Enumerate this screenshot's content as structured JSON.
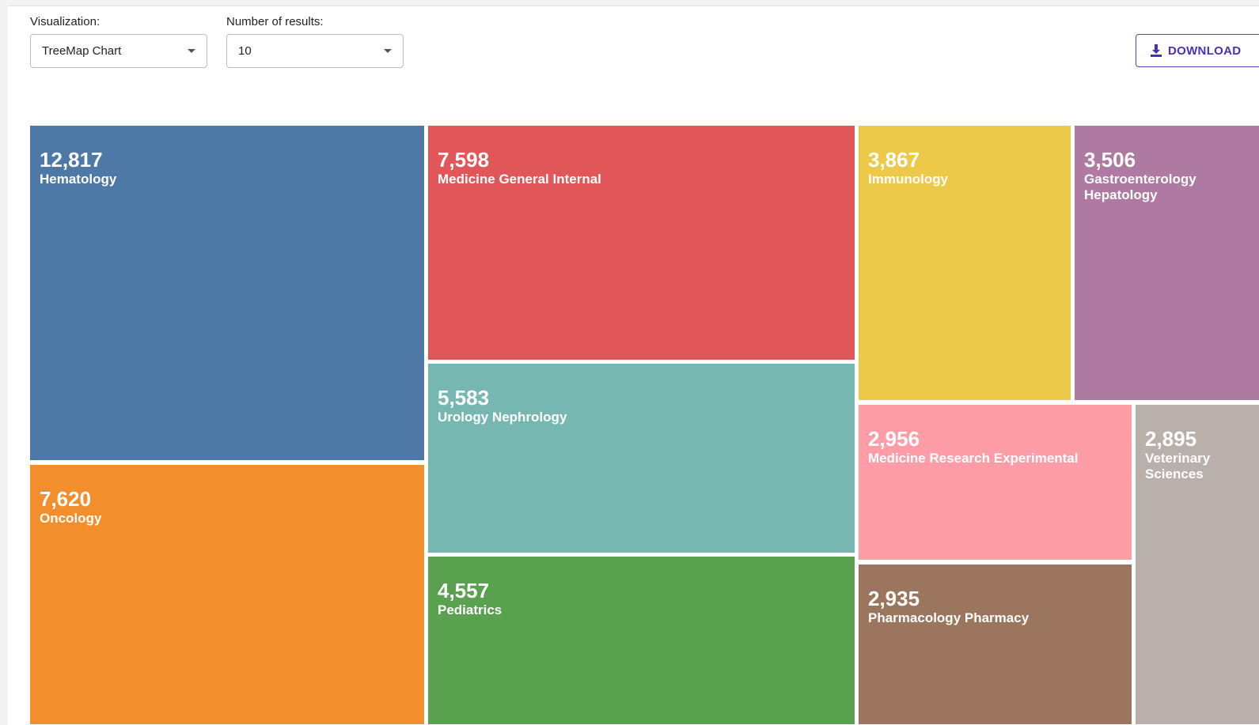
{
  "controls": {
    "visualization_label": "Visualization:",
    "visualization_value": "TreeMap Chart",
    "results_label": "Number of results:",
    "results_value": "10",
    "download_label": "DOWNLOAD"
  },
  "icons": {
    "dropdown": "chevron-down-icon",
    "download": "download-icon"
  },
  "chart_data": {
    "type": "treemap",
    "title": "",
    "items": [
      {
        "label": "Hematology",
        "value": 12817,
        "value_text": "12,817",
        "color": "#4e79a7"
      },
      {
        "label": "Oncology",
        "value": 7620,
        "value_text": "7,620",
        "color": "#f28e2b"
      },
      {
        "label": "Medicine General Internal",
        "value": 7598,
        "value_text": "7,598",
        "color": "#e15759"
      },
      {
        "label": "Urology Nephrology",
        "value": 5583,
        "value_text": "5,583",
        "color": "#76b7b2"
      },
      {
        "label": "Pediatrics",
        "value": 4557,
        "value_text": "4,557",
        "color": "#59a14f"
      },
      {
        "label": "Immunology",
        "value": 3867,
        "value_text": "3,867",
        "color": "#edc949"
      },
      {
        "label": "Gastroenterology Hepatology",
        "value": 3506,
        "value_text": "3,506",
        "color": "#af7aa1"
      },
      {
        "label": "Medicine Research Experimental",
        "value": 2956,
        "value_text": "2,956",
        "color": "#ff9da7"
      },
      {
        "label": "Veterinary Sciences",
        "value": 2895,
        "value_text": "2,895",
        "color": "#bab0ab"
      },
      {
        "label": "Pharmacology Pharmacy",
        "value": 2935,
        "value_text": "2,935",
        "color": "#9c755f"
      }
    ]
  }
}
